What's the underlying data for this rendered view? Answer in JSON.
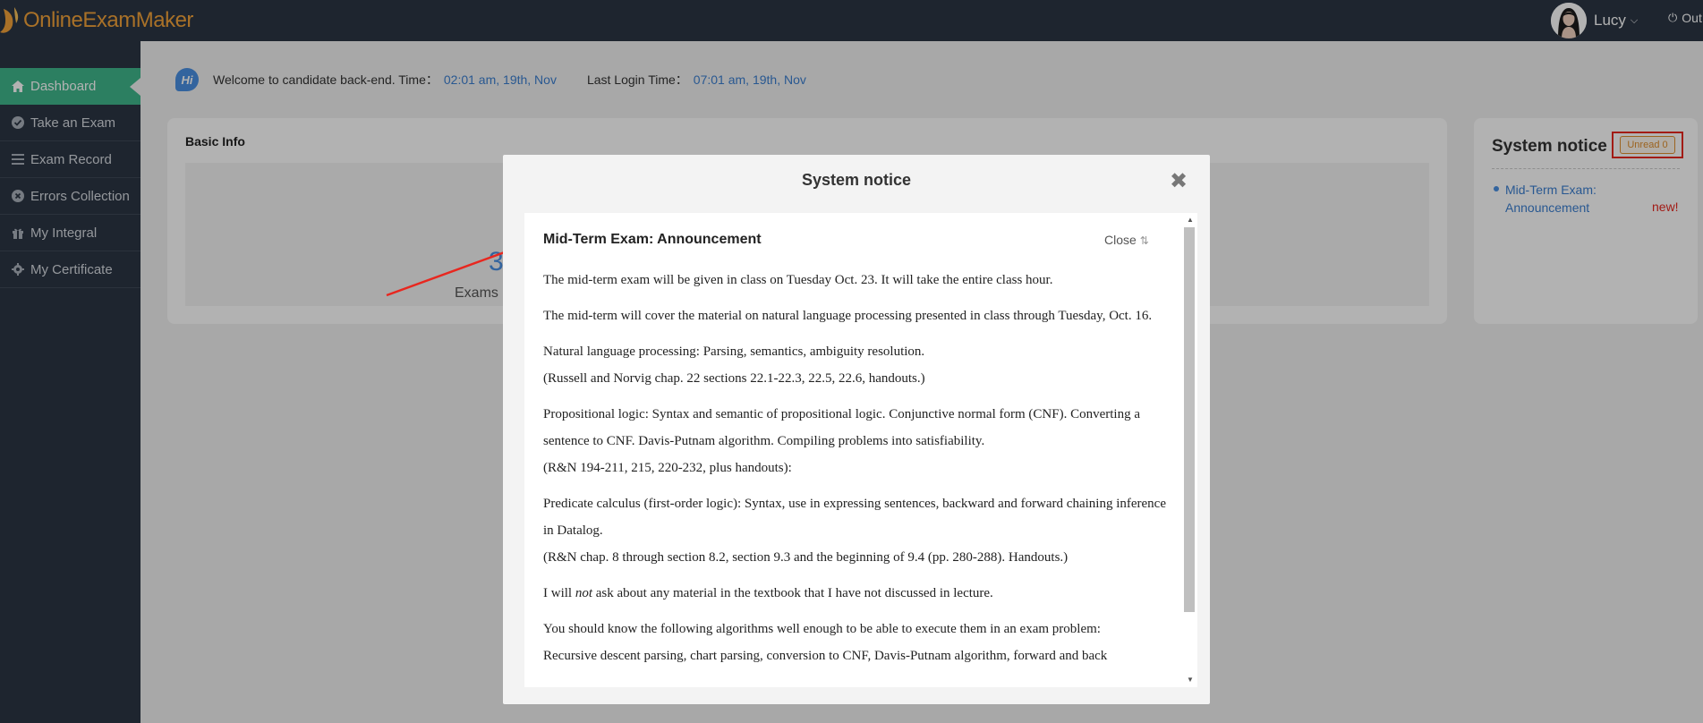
{
  "app": {
    "logo_text": "OnlineExamMaker"
  },
  "user": {
    "name": "Lucy",
    "logout_label": "Out"
  },
  "sidebar": {
    "items": [
      {
        "label": "Dashboard",
        "icon": "home-icon",
        "active": true
      },
      {
        "label": "Take an Exam",
        "icon": "check-circle-icon"
      },
      {
        "label": "Exam Record",
        "icon": "list-icon"
      },
      {
        "label": "Errors Collection",
        "icon": "x-circle-icon"
      },
      {
        "label": "My Integral",
        "icon": "gift-icon"
      },
      {
        "label": "My Certificate",
        "icon": "gear-icon"
      }
    ]
  },
  "welcome": {
    "badge": "Hi",
    "text": "Welcome to candidate back-end. Time：",
    "time": "02:01 am, 19th, Nov",
    "last_login_label": "Last Login Time：",
    "last_login": "07:01 am, 19th, Nov"
  },
  "basic_info": {
    "title": "Basic Info",
    "stat_value": "3",
    "stat_label": "Exams Co"
  },
  "system_notice": {
    "title": "System notice",
    "unread_label": "Unread 0",
    "items": [
      {
        "title": "Mid-Term Exam: Announcement",
        "badge": "new!"
      }
    ]
  },
  "modal": {
    "title": "System notice",
    "close_symbol": "✖",
    "announcement_title": "Mid-Term Exam: Announcement",
    "close_label": "Close",
    "paragraphs": [
      [
        "The mid-term exam will be given in class on Tuesday Oct. 23. It will take the entire class hour."
      ],
      [
        "The mid-term will cover the material on natural language processing presented in class through Tuesday, Oct. 16."
      ],
      [
        "Natural language processing: Parsing, semantics, ambiguity resolution.",
        "(Russell and Norvig chap. 22 sections 22.1-22.3, 22.5, 22.6, handouts.)"
      ],
      [
        "Propositional logic: Syntax and semantic of propositional logic. Conjunctive normal form (CNF). Converting a sentence to CNF. Davis-Putnam algorithm. Compiling problems into satisfiability.",
        "(R&N 194-211, 215, 220-232, plus handouts):"
      ],
      [
        "Predicate calculus (first-order logic): Syntax, use in expressing sentences, backward and forward chaining inference in Datalog.",
        "(R&N chap. 8 through section 8.2, section 9.3 and the beginning of 9.4 (pp. 280-288). Handouts.)"
      ],
      [
        "I will not ask about any material in the textbook that I have not discussed in lecture."
      ],
      [
        "You should know the following algorithms well enough to be able to execute them in an exam problem:",
        "Recursive descent parsing, chart parsing, conversion to CNF, Davis-Putnam algorithm, forward and back"
      ]
    ]
  },
  "colors": {
    "sidebar_bg": "#2b3544",
    "active_green": "#3fb68b",
    "link_blue": "#3b7fd0",
    "logo_orange": "#f2a33a",
    "highlight_red": "#e8271f"
  }
}
